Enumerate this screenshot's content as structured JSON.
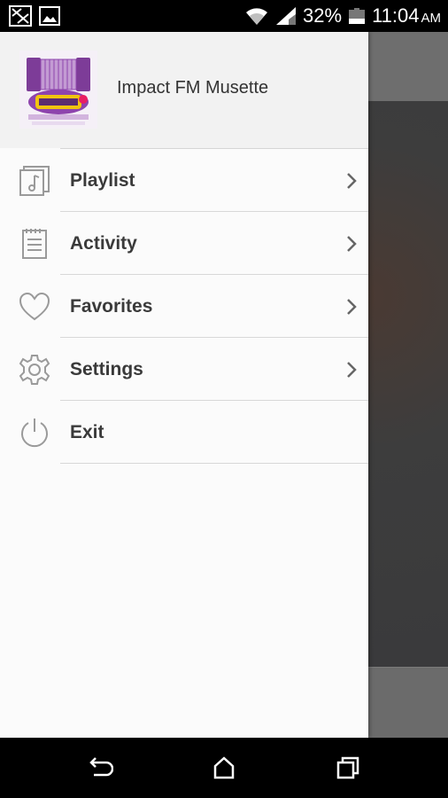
{
  "status_bar": {
    "battery_percent": "32%",
    "time": "11:04",
    "ampm": "AM",
    "icons": [
      "notification-icon",
      "image-icon",
      "wifi-icon",
      "signal-icon",
      "battery-icon"
    ]
  },
  "drawer": {
    "station_name": "Impact FM Musette",
    "logo_icon": "station-logo-accordion",
    "items": [
      {
        "label": "Playlist",
        "icon": "music-note-icon",
        "has_chevron": true
      },
      {
        "label": "Activity",
        "icon": "notepad-icon",
        "has_chevron": true
      },
      {
        "label": "Favorites",
        "icon": "heart-icon",
        "has_chevron": true
      },
      {
        "label": "Settings",
        "icon": "gear-icon",
        "has_chevron": true
      },
      {
        "label": "Exit",
        "icon": "power-icon",
        "has_chevron": false
      }
    ]
  },
  "nav_bar": {
    "buttons": [
      "back-icon",
      "home-icon",
      "recents-icon"
    ]
  },
  "colors": {
    "drawer_bg": "#fbfbfb",
    "header_bg": "#f2f2f2",
    "label_text": "#3a3a3a",
    "icon_gray": "#9a9a9a",
    "logo_purple": "#8e44ad",
    "logo_yellow": "#f1c40f"
  }
}
